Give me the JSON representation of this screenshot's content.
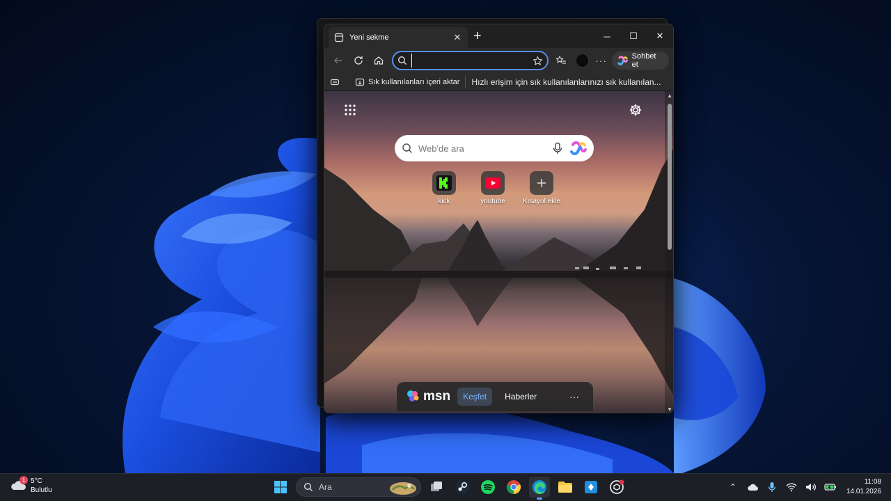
{
  "browser": {
    "tab": {
      "title": "Yeni sekme"
    },
    "address_bar": {
      "value": ""
    },
    "copilot_button": {
      "label": "Sohbet et"
    },
    "favorites_bar": {
      "import_label": "Sık kullanılanları içeri aktar",
      "hint": "Hızlı erişim için sık kullanılanlarınızı sık kullanılan..."
    }
  },
  "new_tab": {
    "search": {
      "placeholder": "Web'de ara"
    },
    "shortcuts": [
      {
        "label": "kick",
        "icon": "kick-icon",
        "color": "#53fc18"
      },
      {
        "label": "youtube",
        "icon": "youtube-icon",
        "color": "#ff0033"
      },
      {
        "label": "Kısayol ekle",
        "icon": "plus-icon"
      }
    ],
    "msn": {
      "logo": "msn",
      "tabs": [
        {
          "label": "Keşfet",
          "active": true
        },
        {
          "label": "Haberler",
          "active": false
        }
      ],
      "more": "···"
    }
  },
  "taskbar": {
    "weather": {
      "temp": "5°C",
      "condition": "Bulutlu",
      "badge": "1"
    },
    "search": {
      "placeholder": "Ara"
    },
    "apps": [
      "start-icon",
      "search",
      "task-view-icon",
      "steam-icon",
      "spotify-icon",
      "chrome-icon",
      "edge-icon",
      "file-explorer-icon",
      "app-icon",
      "chatgpt-icon"
    ],
    "clock": {
      "time": "11:08",
      "date": "14.01.2026"
    }
  },
  "colors": {
    "accent": "#5a8ee8",
    "taskbar": "#1c1f26",
    "window": "#202020"
  }
}
